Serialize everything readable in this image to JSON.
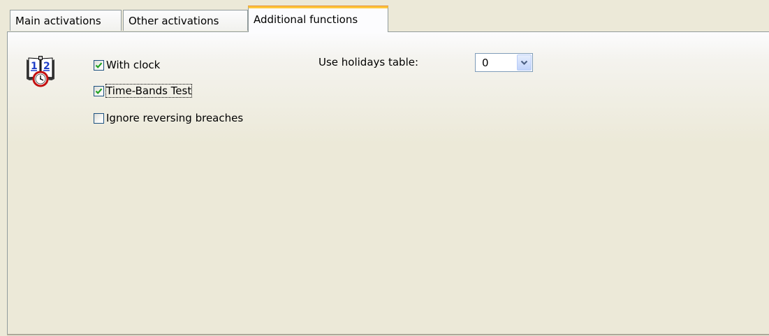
{
  "tabs": [
    {
      "label": "Main activations",
      "active": false
    },
    {
      "label": "Other activations",
      "active": false
    },
    {
      "label": "Additional functions",
      "active": true
    }
  ],
  "icon": "calendar-clock-icon",
  "calendar_icon_digits": "1 2",
  "options": {
    "with_clock": {
      "label": "With clock",
      "checked": true
    },
    "time_bands_test": {
      "label": "Time-Bands Test",
      "checked": true
    },
    "ignore_reversing_breaches": {
      "label": "Ignore reversing breaches",
      "checked": false
    }
  },
  "holidays": {
    "label": "Use holidays table:",
    "value": "0"
  },
  "colors": {
    "accent_tab": "#ffc83c",
    "check_green": "#21a121",
    "panel_bg": "#ece9d8"
  }
}
